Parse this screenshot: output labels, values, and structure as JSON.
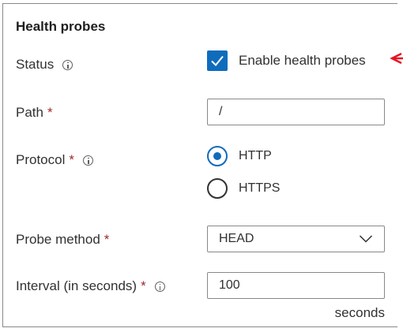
{
  "section": {
    "title": "Health probes"
  },
  "status": {
    "label": "Status",
    "checkbox_label": "Enable health probes",
    "checked": true
  },
  "path": {
    "label": "Path",
    "required_mark": "*",
    "value": "/"
  },
  "protocol": {
    "label": "Protocol",
    "required_mark": "*",
    "options": [
      {
        "label": "HTTP",
        "selected": true
      },
      {
        "label": "HTTPS",
        "selected": false
      }
    ]
  },
  "probe_method": {
    "label": "Probe method",
    "required_mark": "*",
    "value": "HEAD"
  },
  "interval": {
    "label": "Interval (in seconds)",
    "required_mark": "*",
    "value": "100",
    "suffix": "seconds"
  },
  "colors": {
    "accent": "#0f6cbd",
    "required": "#a4262c",
    "annotation": "#e81123"
  }
}
